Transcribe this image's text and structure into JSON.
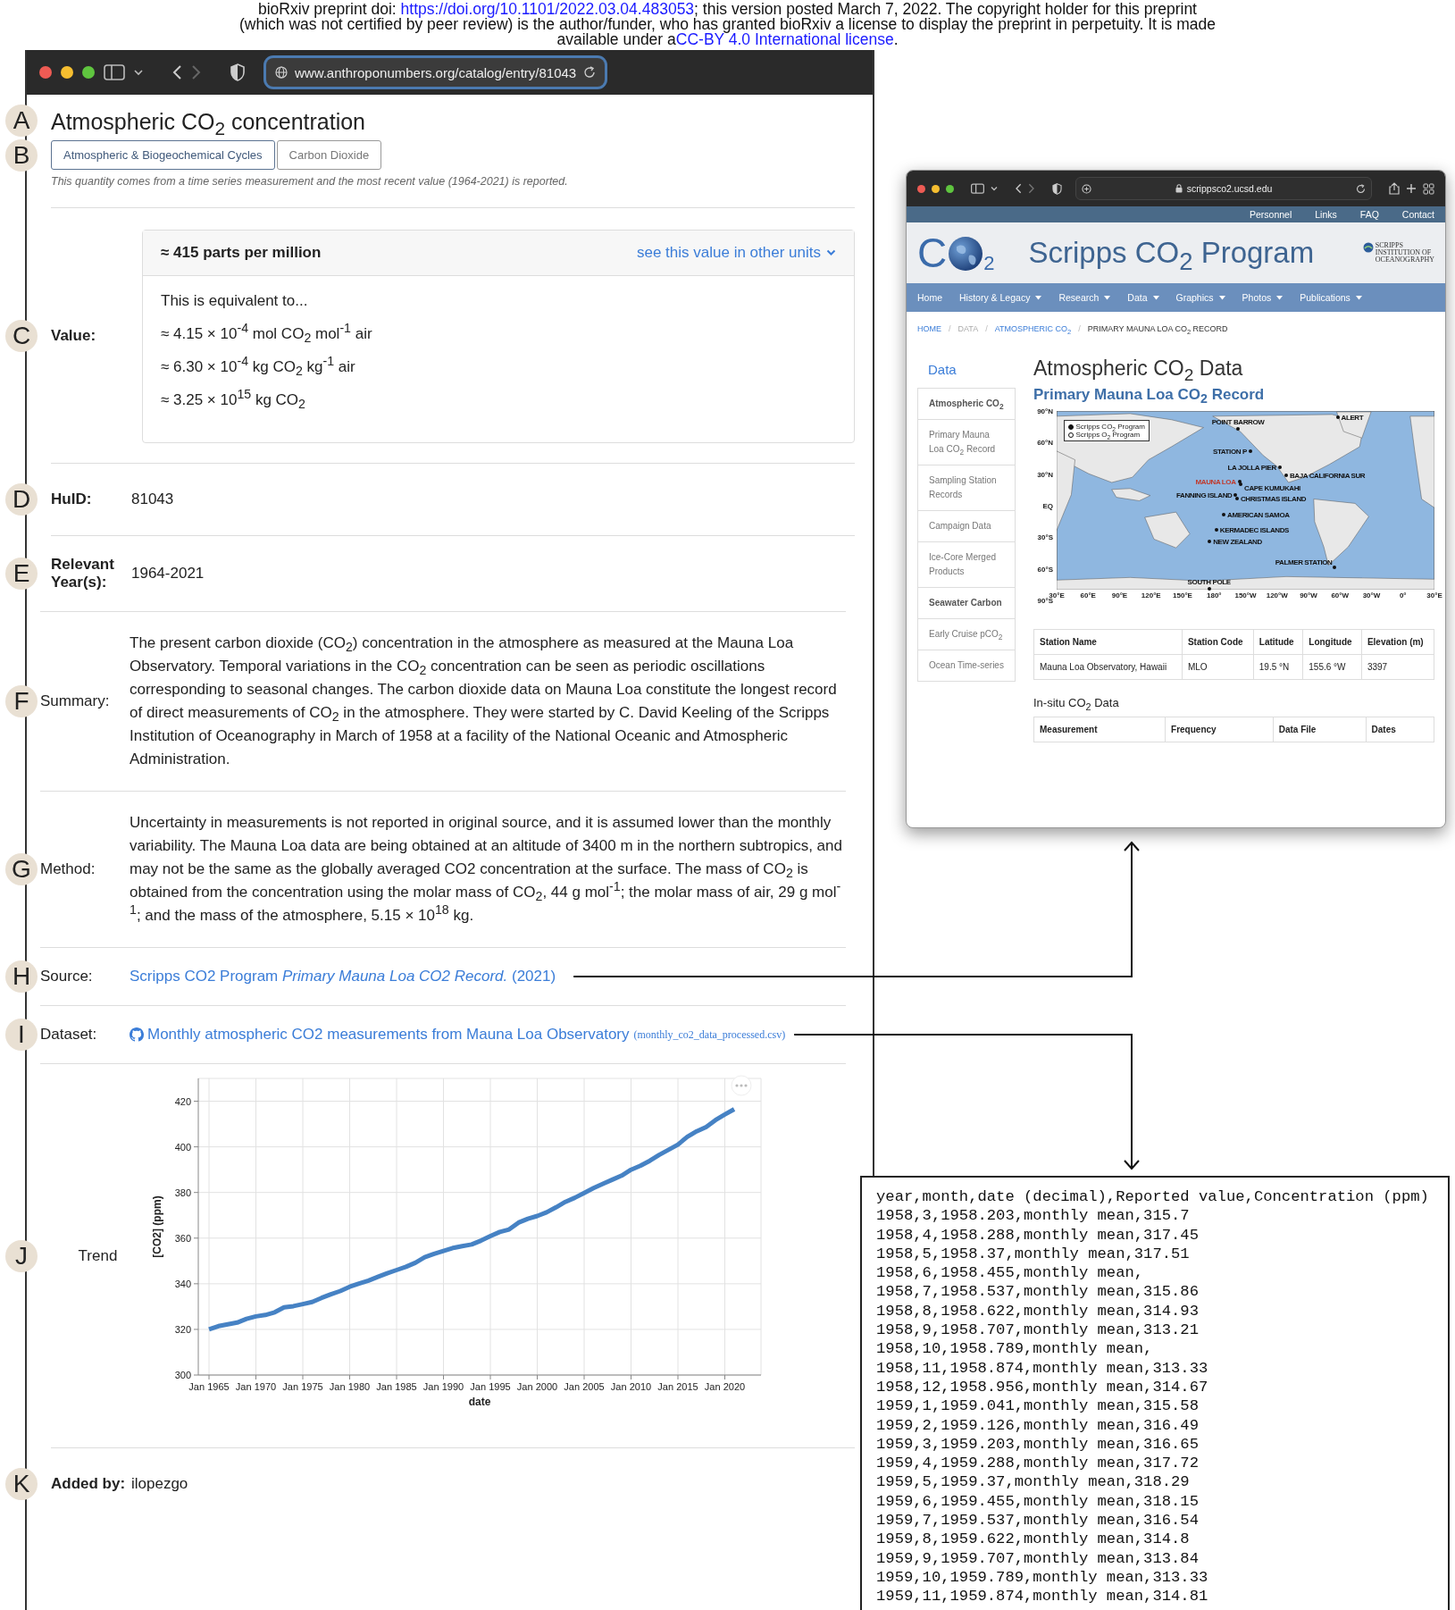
{
  "notice": [
    {
      "text": "bioRxiv preprint doi: ",
      "link": "https://doi.org/10.1101/2022.03.04.483053",
      "after": "; this version posted March 7, 2022. The copyright holder for this preprint"
    },
    {
      "text": "(which was not certified by peer review) is the author/funder, who has granted bioRxiv a license to display the preprint in perpetuity. It is made"
    },
    {
      "text": "available under a",
      "link": "CC-BY 4.0 International license",
      "after": "."
    }
  ],
  "entry_window": {
    "url": "www.anthroponumbers.org/catalog/entry/81043",
    "title": {
      "marker": "A",
      "text": "Atmospheric CO$_{2}$ concentration"
    },
    "tags": {
      "marker": "B",
      "items": [
        {
          "label": "Atmospheric & Biogeochemical Cycles",
          "kind": "primary"
        },
        {
          "label": "Carbon Dioxide",
          "kind": "secondary"
        }
      ]
    },
    "note": "This quantity comes from a time series measurement and the most recent value (1964-2021) is reported.",
    "rows": [
      {
        "kind": "value",
        "marker": "C",
        "label": "Value:",
        "headline": "≈ 415 parts per million",
        "units_link": "see this value in other units",
        "intro": "This is equivalent to...",
        "equivalents": [
          "≈ 4.15 × 10$^{-4}$ mol CO$_{2}$ mol$^{-1}$ air",
          "≈ 6.30 × 10$^{-4}$ kg CO$_{2}$ kg$^{-1}$ air",
          "≈ 3.25 × 10$^{15}$ kg CO$_{2}$"
        ]
      },
      {
        "kind": "text",
        "marker": "D",
        "label": "HuID:",
        "value": "81043"
      },
      {
        "kind": "text",
        "marker": "E",
        "label": "Relevant Year(s):",
        "value": "1964-2021"
      },
      {
        "kind": "paragraph",
        "marker": "F",
        "label": "Summary:",
        "text": "The present carbon dioxide (CO$_{2}$) concentration in the atmosphere as measured at the Mauna Loa Observatory. Temporal variations in the CO$_{2}$ concentration can be seen as periodic oscillations corresponding to seasonal changes. The carbon dioxide data on Mauna Loa constitute the longest record of direct measurements of CO$_{2}$ in the atmosphere. They were started by C. David Keeling of the Scripps Institution of Oceanography in March of 1958 at a facility of the National Oceanic and Atmospheric Administration."
      },
      {
        "kind": "paragraph",
        "marker": "G",
        "label": "Method:",
        "text": "Uncertainty in measurements is not reported in original source, and it is assumed lower than the monthly variability. The Mauna Loa data are being obtained at an altitude of 3400 m in the northern subtropics, and may not be the same as the globally averaged CO2 concentration at the surface. The mass of CO$_{2}$ is obtained from the concentration using the molar mass of CO$_{2}$, 44 g mol$^{-1}$; the molar mass of air, 29 g mol$^{-1}$; and the mass of the atmosphere, 5.15 × 10$^{18}$ kg."
      },
      {
        "kind": "source",
        "marker": "H",
        "label": "Source:",
        "link": "Scripps CO2 Program *Primary Mauna Loa CO2 Record.* (2021)"
      },
      {
        "kind": "dataset",
        "marker": "I",
        "label": "Dataset:",
        "link": "Monthly atmospheric CO2 measurements from Mauna Loa Observatory",
        "file": "(monthly_co2_data_processed.csv)"
      },
      {
        "kind": "chart",
        "marker": "J",
        "label": "Trend",
        "chart_data": {
          "type": "line",
          "xlabel": "date",
          "ylabel": "[CO2] (ppm)",
          "categories": [
            "Jan 1965",
            null,
            null,
            null,
            null,
            "Jan 1970",
            null,
            null,
            null,
            null,
            "Jan 1975",
            null,
            null,
            null,
            null,
            "Jan 1980",
            null,
            null,
            null,
            null,
            "Jan 1985",
            null,
            null,
            null,
            null,
            "Jan 1990",
            null,
            null,
            null,
            null,
            "Jan 1995",
            null,
            null,
            null,
            null,
            "Jan 2000",
            null,
            null,
            null,
            null,
            "Jan 2005",
            null,
            null,
            null,
            null,
            "Jan 2010",
            null,
            null,
            null,
            null,
            "Jan 2015",
            null,
            null,
            null,
            null,
            "Jan 2020",
            null
          ],
          "series": [
            {
              "color": "#4682c4",
              "values": [
                320.0,
                321.4,
                322.2,
                323.0,
                324.6,
                325.7,
                326.3,
                327.5,
                329.7,
                330.2,
                331.1,
                332.0,
                333.8,
                335.4,
                336.8,
                338.7,
                340.1,
                341.4,
                343.0,
                344.6,
                346.0,
                347.4,
                349.2,
                351.6,
                353.1,
                354.4,
                355.7,
                356.5,
                357.2,
                358.9,
                360.9,
                362.7,
                363.8,
                366.8,
                368.5,
                369.7,
                371.3,
                373.5,
                375.9,
                377.7,
                379.8,
                381.9,
                383.8,
                385.6,
                387.4,
                390.0,
                391.7,
                393.9,
                396.5,
                398.7,
                401.0,
                404.4,
                406.8,
                408.7,
                411.7,
                414.2,
                416.5
              ]
            }
          ],
          "ylim": [
            300,
            430
          ],
          "grid": true,
          "yticks": [
            300,
            320,
            340,
            360,
            380,
            400,
            420
          ]
        }
      },
      {
        "kind": "text",
        "marker": "K",
        "label": "Added by:",
        "value": "ilopezgo"
      }
    ]
  },
  "scripps_window": {
    "url": "scrippsco2.ucsd.edu",
    "top_links": [
      "Personnel",
      "Links",
      "FAQ",
      "Contact"
    ],
    "logo": {
      "letter": "C",
      "subscript": "2"
    },
    "site_title": "Scripps CO$_{2}$ Program",
    "institution_logo": [
      "SCRIPPS",
      "INSTITUTION OF",
      "OCEANOGRAPHY"
    ],
    "nav": [
      {
        "label": "Home",
        "has_menu": false
      },
      {
        "label": "History & Legacy",
        "has_menu": true
      },
      {
        "label": "Research",
        "has_menu": true
      },
      {
        "label": "Data",
        "has_menu": true
      },
      {
        "label": "Graphics",
        "has_menu": true
      },
      {
        "label": "Photos",
        "has_menu": true
      },
      {
        "label": "Publications",
        "has_menu": true
      }
    ],
    "breadcrumb_separator": "/",
    "breadcrumb": [
      {
        "label": "HOME",
        "kind": "link"
      },
      {
        "label": "DATA",
        "kind": "muted"
      },
      {
        "label": "ATMOSPHERIC CO$_{2}$",
        "kind": "link"
      },
      {
        "label": "PRIMARY MAUNA LOA CO$_{2}$ RECORD",
        "kind": "current"
      }
    ],
    "sidebar": {
      "title": "Data",
      "items": [
        {
          "label": "Atmospheric CO$_{2}$",
          "kind": "heading"
        },
        {
          "label": "Primary Mauna Loa CO$_{2}$ Record",
          "kind": "link"
        },
        {
          "label": "Sampling Station Records",
          "kind": "link"
        },
        {
          "label": "Campaign Data",
          "kind": "link"
        },
        {
          "label": "Ice-Core Merged Products",
          "kind": "link"
        },
        {
          "label": "Seawater Carbon",
          "kind": "heading"
        },
        {
          "label": "Early Cruise pCO$_{2}$",
          "kind": "link"
        },
        {
          "label": "Ocean Time-series",
          "kind": "link"
        }
      ]
    },
    "page_title": "Atmospheric CO$_{2}$ Data",
    "subtitle": "Primary Mauna Loa CO$_{2}$ Record",
    "map": {
      "legend": [
        {
          "label": "Scripps CO$_{2}$ Program",
          "kind": "filled"
        },
        {
          "label": "Scripps O$_{2}$ Program",
          "kind": "hollow"
        }
      ],
      "stations": [
        {
          "label": "POINT BARROW",
          "highlighted": false
        },
        {
          "label": "ALERT",
          "highlighted": false
        },
        {
          "label": "STATION P",
          "highlighted": false
        },
        {
          "label": "LA JOLLA PIER",
          "highlighted": false
        },
        {
          "label": "BAJA CALIFORNIA SUR",
          "highlighted": false
        },
        {
          "label": "MAUNA LOA",
          "highlighted": true
        },
        {
          "label": "CAPE KUMUKAHI",
          "highlighted": false
        },
        {
          "label": "FANNING ISLAND",
          "highlighted": false
        },
        {
          "label": "CHRISTMAS ISLAND",
          "highlighted": false
        },
        {
          "label": "AMERICAN SAMOA",
          "highlighted": false
        },
        {
          "label": "KERMADEC ISLANDS",
          "highlighted": false
        },
        {
          "label": "NEW ZEALAND",
          "highlighted": false
        },
        {
          "label": "PALMER STATION",
          "highlighted": false
        },
        {
          "label": "SOUTH POLE",
          "highlighted": false
        }
      ],
      "lat_ticks": [
        "90°N",
        "60°N",
        "30°N",
        "EQ",
        "30°S",
        "60°S",
        "90°S"
      ],
      "lon_ticks": [
        "30°E",
        "60°E",
        "90°E",
        "120°E",
        "150°E",
        "180°",
        "150°W",
        "120°W",
        "90°W",
        "60°W",
        "30°W",
        "0°",
        "30°E"
      ]
    },
    "station_table": {
      "columns": [
        "Station Name",
        "Station Code",
        "Latitude",
        "Longitude",
        "Elevation (m)"
      ],
      "rows": [
        [
          "Mauna Loa Observatory, Hawaii",
          "MLO",
          "19.5 °N",
          "155.6 °W",
          "3397"
        ]
      ]
    },
    "insitu_title": "In-situ CO$_{2}$ Data",
    "insitu_columns": [
      "Measurement",
      "Frequency",
      "Data File",
      "Dates"
    ]
  },
  "csv": {
    "lines": [
      "year,month,date (decimal),Reported value,Concentration (ppm)",
      "1958,3,1958.203,monthly mean,315.7",
      "1958,4,1958.288,monthly mean,317.45",
      "1958,5,1958.37,monthly mean,317.51",
      "1958,6,1958.455,monthly mean,",
      "1958,7,1958.537,monthly mean,315.86",
      "1958,8,1958.622,monthly mean,314.93",
      "1958,9,1958.707,monthly mean,313.21",
      "1958,10,1958.789,monthly mean,",
      "1958,11,1958.874,monthly mean,313.33",
      "1958,12,1958.956,monthly mean,314.67",
      "1959,1,1959.041,monthly mean,315.58",
      "1959,2,1959.126,monthly mean,316.49",
      "1959,3,1959.203,monthly mean,316.65",
      "1959,4,1959.288,monthly mean,317.72",
      "1959,5,1959.37,monthly mean,318.29",
      "1959,6,1959.455,monthly mean,318.15",
      "1959,7,1959.537,monthly mean,316.54",
      "1959,8,1959.622,monthly mean,314.8",
      "1959,9,1959.707,monthly mean,313.84",
      "1959,10,1959.789,monthly mean,313.33",
      "1959,11,1959.874,monthly mean,314.81"
    ]
  }
}
